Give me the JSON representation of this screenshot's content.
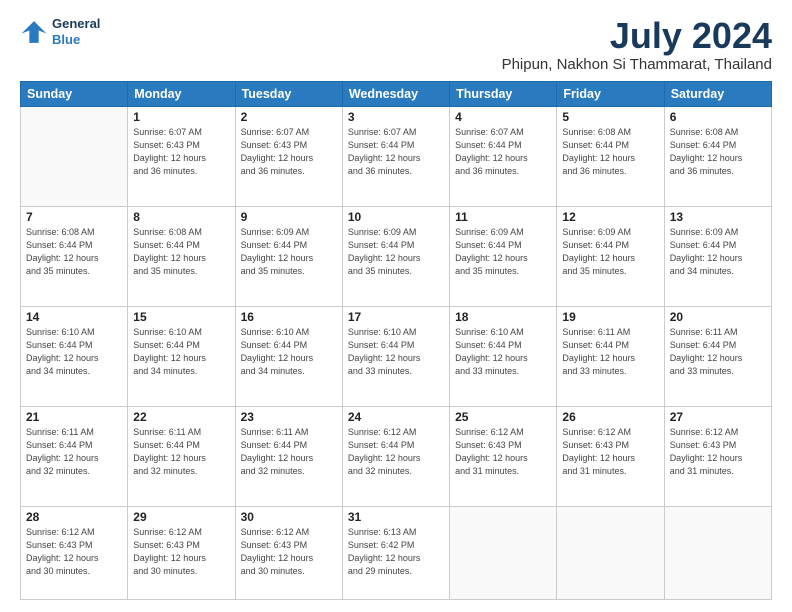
{
  "logo": {
    "line1": "General",
    "line2": "Blue"
  },
  "title": "July 2024",
  "location": "Phipun, Nakhon Si Thammarat, Thailand",
  "headers": [
    "Sunday",
    "Monday",
    "Tuesday",
    "Wednesday",
    "Thursday",
    "Friday",
    "Saturday"
  ],
  "weeks": [
    [
      {
        "num": "",
        "info": ""
      },
      {
        "num": "1",
        "info": "Sunrise: 6:07 AM\nSunset: 6:43 PM\nDaylight: 12 hours\nand 36 minutes."
      },
      {
        "num": "2",
        "info": "Sunrise: 6:07 AM\nSunset: 6:43 PM\nDaylight: 12 hours\nand 36 minutes."
      },
      {
        "num": "3",
        "info": "Sunrise: 6:07 AM\nSunset: 6:44 PM\nDaylight: 12 hours\nand 36 minutes."
      },
      {
        "num": "4",
        "info": "Sunrise: 6:07 AM\nSunset: 6:44 PM\nDaylight: 12 hours\nand 36 minutes."
      },
      {
        "num": "5",
        "info": "Sunrise: 6:08 AM\nSunset: 6:44 PM\nDaylight: 12 hours\nand 36 minutes."
      },
      {
        "num": "6",
        "info": "Sunrise: 6:08 AM\nSunset: 6:44 PM\nDaylight: 12 hours\nand 36 minutes."
      }
    ],
    [
      {
        "num": "7",
        "info": "Sunrise: 6:08 AM\nSunset: 6:44 PM\nDaylight: 12 hours\nand 35 minutes."
      },
      {
        "num": "8",
        "info": "Sunrise: 6:08 AM\nSunset: 6:44 PM\nDaylight: 12 hours\nand 35 minutes."
      },
      {
        "num": "9",
        "info": "Sunrise: 6:09 AM\nSunset: 6:44 PM\nDaylight: 12 hours\nand 35 minutes."
      },
      {
        "num": "10",
        "info": "Sunrise: 6:09 AM\nSunset: 6:44 PM\nDaylight: 12 hours\nand 35 minutes."
      },
      {
        "num": "11",
        "info": "Sunrise: 6:09 AM\nSunset: 6:44 PM\nDaylight: 12 hours\nand 35 minutes."
      },
      {
        "num": "12",
        "info": "Sunrise: 6:09 AM\nSunset: 6:44 PM\nDaylight: 12 hours\nand 35 minutes."
      },
      {
        "num": "13",
        "info": "Sunrise: 6:09 AM\nSunset: 6:44 PM\nDaylight: 12 hours\nand 34 minutes."
      }
    ],
    [
      {
        "num": "14",
        "info": "Sunrise: 6:10 AM\nSunset: 6:44 PM\nDaylight: 12 hours\nand 34 minutes."
      },
      {
        "num": "15",
        "info": "Sunrise: 6:10 AM\nSunset: 6:44 PM\nDaylight: 12 hours\nand 34 minutes."
      },
      {
        "num": "16",
        "info": "Sunrise: 6:10 AM\nSunset: 6:44 PM\nDaylight: 12 hours\nand 34 minutes."
      },
      {
        "num": "17",
        "info": "Sunrise: 6:10 AM\nSunset: 6:44 PM\nDaylight: 12 hours\nand 33 minutes."
      },
      {
        "num": "18",
        "info": "Sunrise: 6:10 AM\nSunset: 6:44 PM\nDaylight: 12 hours\nand 33 minutes."
      },
      {
        "num": "19",
        "info": "Sunrise: 6:11 AM\nSunset: 6:44 PM\nDaylight: 12 hours\nand 33 minutes."
      },
      {
        "num": "20",
        "info": "Sunrise: 6:11 AM\nSunset: 6:44 PM\nDaylight: 12 hours\nand 33 minutes."
      }
    ],
    [
      {
        "num": "21",
        "info": "Sunrise: 6:11 AM\nSunset: 6:44 PM\nDaylight: 12 hours\nand 32 minutes."
      },
      {
        "num": "22",
        "info": "Sunrise: 6:11 AM\nSunset: 6:44 PM\nDaylight: 12 hours\nand 32 minutes."
      },
      {
        "num": "23",
        "info": "Sunrise: 6:11 AM\nSunset: 6:44 PM\nDaylight: 12 hours\nand 32 minutes."
      },
      {
        "num": "24",
        "info": "Sunrise: 6:12 AM\nSunset: 6:44 PM\nDaylight: 12 hours\nand 32 minutes."
      },
      {
        "num": "25",
        "info": "Sunrise: 6:12 AM\nSunset: 6:43 PM\nDaylight: 12 hours\nand 31 minutes."
      },
      {
        "num": "26",
        "info": "Sunrise: 6:12 AM\nSunset: 6:43 PM\nDaylight: 12 hours\nand 31 minutes."
      },
      {
        "num": "27",
        "info": "Sunrise: 6:12 AM\nSunset: 6:43 PM\nDaylight: 12 hours\nand 31 minutes."
      }
    ],
    [
      {
        "num": "28",
        "info": "Sunrise: 6:12 AM\nSunset: 6:43 PM\nDaylight: 12 hours\nand 30 minutes."
      },
      {
        "num": "29",
        "info": "Sunrise: 6:12 AM\nSunset: 6:43 PM\nDaylight: 12 hours\nand 30 minutes."
      },
      {
        "num": "30",
        "info": "Sunrise: 6:12 AM\nSunset: 6:43 PM\nDaylight: 12 hours\nand 30 minutes."
      },
      {
        "num": "31",
        "info": "Sunrise: 6:13 AM\nSunset: 6:42 PM\nDaylight: 12 hours\nand 29 minutes."
      },
      {
        "num": "",
        "info": ""
      },
      {
        "num": "",
        "info": ""
      },
      {
        "num": "",
        "info": ""
      }
    ]
  ]
}
